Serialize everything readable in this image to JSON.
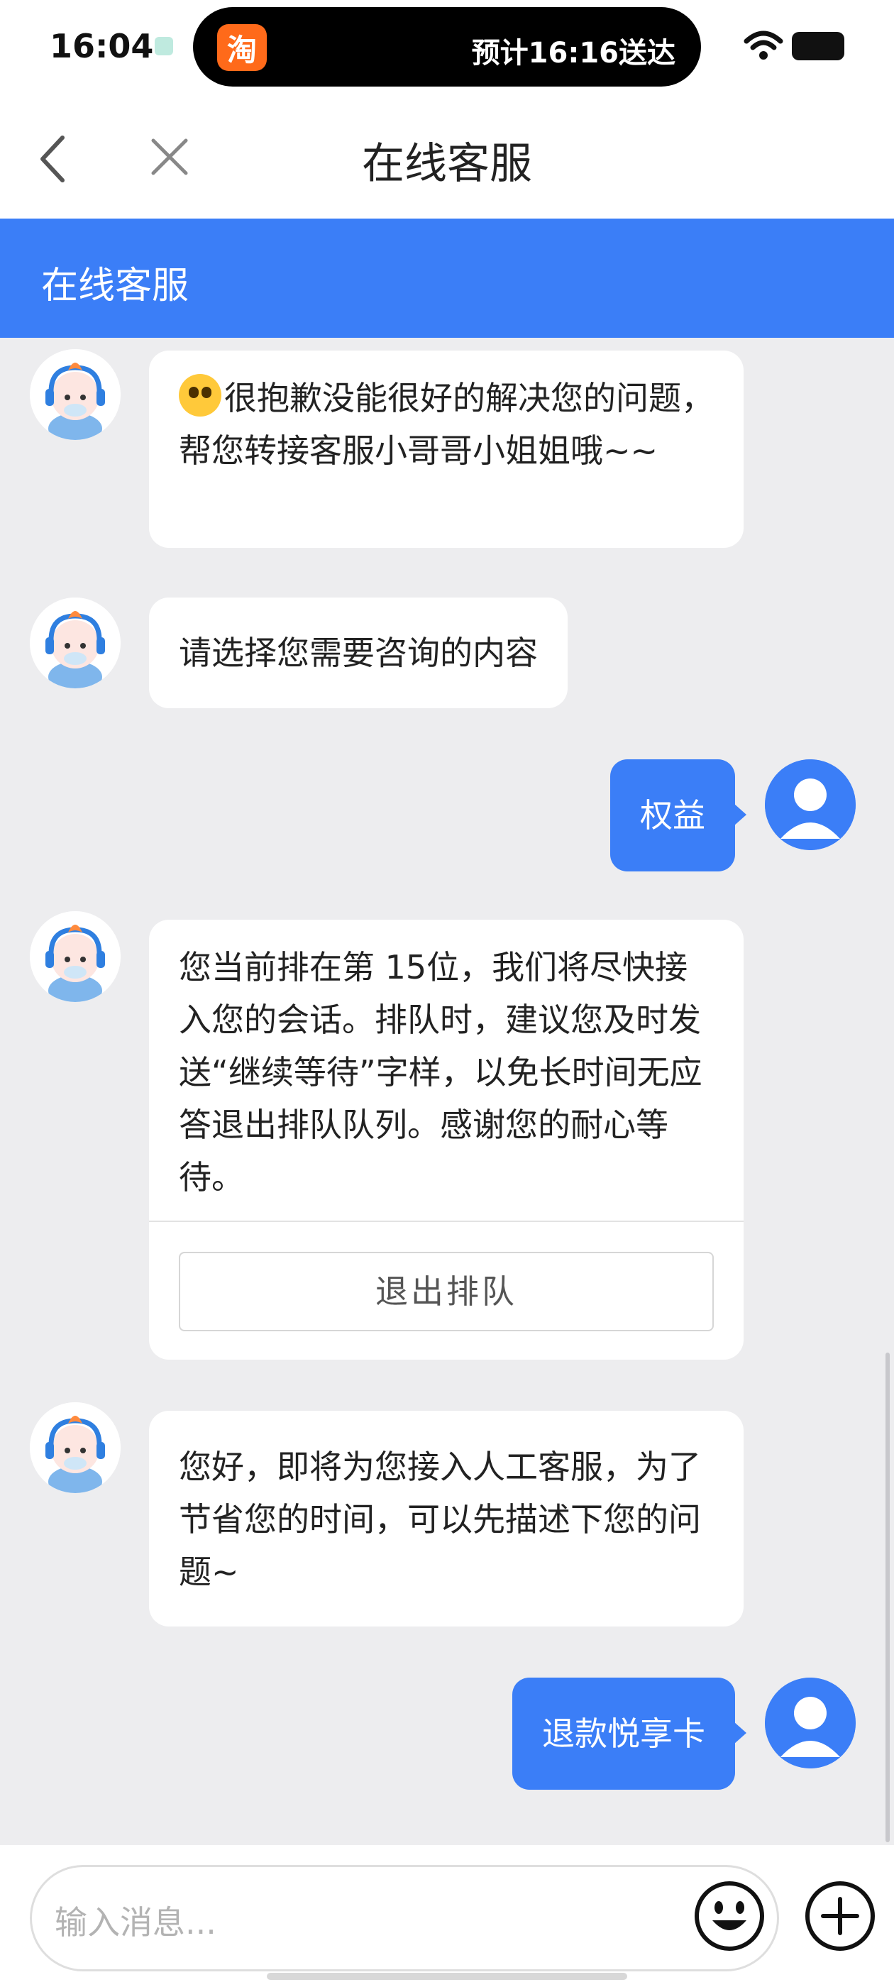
{
  "status_bar": {
    "time": "16:04",
    "island_app": "淘",
    "island_text": "预计16:16送达"
  },
  "nav": {
    "title": "在线客服"
  },
  "service_header": {
    "title": "在线客服"
  },
  "messages": {
    "m1": {
      "sender": "bot",
      "emoji": "flushed-face",
      "text": "很抱歉没能很好的解决您的问题，帮您转接客服小哥哥小姐姐哦~~"
    },
    "m2": {
      "sender": "bot",
      "text": "请选择您需要咨询的内容"
    },
    "m3": {
      "sender": "user",
      "text": "权益"
    },
    "m4": {
      "sender": "bot",
      "text": "您当前排在第 15位，我们将尽快接入您的会话。排队时，建议您及时发送“继续等待”字样，以免长时间无应答退出排队队列。感谢您的耐心等待。",
      "button_label": "退出排队"
    },
    "m5": {
      "sender": "bot",
      "text": "您好，即将为您接入人工客服，为了节省您的时间，可以先描述下您的问题~"
    },
    "m6": {
      "sender": "user",
      "text": "退款悦享卡"
    }
  },
  "input": {
    "placeholder": "输入消息..."
  },
  "colors": {
    "accent": "#3b7ef7",
    "chat_background": "#ededef",
    "bubble": "#ffffff"
  },
  "icons": {
    "back": "chevron-left-icon",
    "close": "close-icon",
    "emoji": "smiley-icon",
    "plus": "plus-icon",
    "bot_avatar": "bot-avatar",
    "user_avatar": "user-avatar"
  }
}
